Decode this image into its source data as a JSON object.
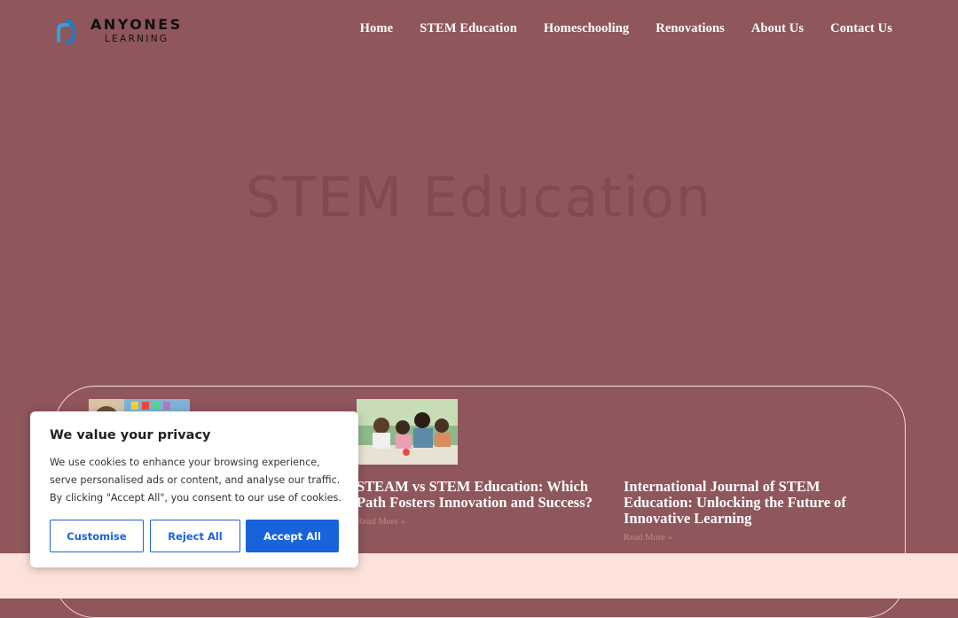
{
  "brand": {
    "name": "ANYONES",
    "sub": "LEARNING"
  },
  "nav": [
    "Home",
    "STEM Education",
    "Homeschooling",
    "Renovations",
    "About Us",
    "Contact Us"
  ],
  "hero": {
    "title": "STEM Education"
  },
  "posts": [
    {
      "title": "",
      "read_more": ""
    },
    {
      "title": "STEAM vs STEM Education: Which Path Fosters Innovation and Success?",
      "read_more": "Read More »"
    },
    {
      "title": "International Journal of STEM Education: Unlocking the Future of Innovative Learning",
      "read_more": "Read More »"
    }
  ],
  "cookie": {
    "title": "We value your privacy",
    "text": "We use cookies to enhance your browsing experience, serve personalised ads or content, and analyse our traffic. By clicking \"Accept All\", you consent to our use of cookies.",
    "customise": "Customise",
    "reject": "Reject All",
    "accept": "Accept All"
  },
  "colors": {
    "background": "#8f565c",
    "footer": "#fde2da",
    "accent": "#1863dc",
    "read_more": "#c9877d"
  }
}
